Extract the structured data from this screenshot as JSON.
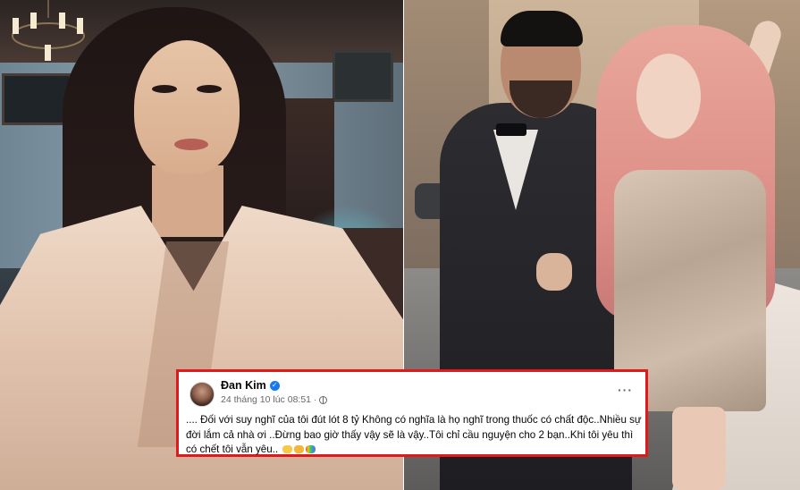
{
  "post": {
    "author": "Đan Kim",
    "verified": true,
    "timestamp": "24 tháng 10 lúc 08:51",
    "separator": "·",
    "visibility_icon": "globe-icon",
    "more_icon": "more-horizontal-icon",
    "more_label": "···",
    "text": ".... Đối với suy nghĩ của tôi đút lót 8 tỷ Không có nghĩa là họ nghĩ trong thuốc có chất độc..Nhiều sự đời lắm cả nhà ơi ..Đừng bao giờ thấy vậy sẽ là vậy..Tôi chỉ cầu nguyện cho 2 bạn..Khi tôi yêu thì có chết tôi vẫn yêu..",
    "emojis": [
      "hands-icon",
      "pray-icon",
      "rainbow-flag-icon"
    ]
  },
  "colors": {
    "highlight_border": "#e0191c",
    "verified_badge": "#1877f2",
    "meta_text": "#65676b"
  }
}
